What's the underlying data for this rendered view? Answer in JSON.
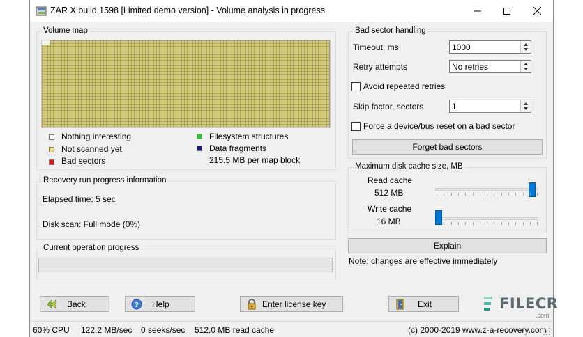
{
  "window": {
    "title": "ZAR X build 1598 [Limited demo version] - Volume analysis in progress"
  },
  "volume_map": {
    "title": "Volume map",
    "legend": [
      {
        "label": "Nothing interesting",
        "color": "#ffffff"
      },
      {
        "label": "Not scanned yet",
        "color": "#f2dc6a"
      },
      {
        "label": "Bad sectors",
        "color": "#e01010"
      },
      {
        "label": "Filesystem structures",
        "color": "#22cc22"
      },
      {
        "label": "Data fragments",
        "color": "#1a1a8a"
      }
    ],
    "per_block": "215.5 MB per map block"
  },
  "recovery": {
    "title": "Recovery run progress information",
    "elapsed": "Elapsed time: 5 sec",
    "disk_scan": "Disk scan: Full mode (0%)"
  },
  "current_op": {
    "title": "Current operation progress",
    "progress": 0
  },
  "bad_sector": {
    "title": "Bad sector handling",
    "timeout_label": "Timeout, ms",
    "timeout_value": "1000",
    "retry_label": "Retry attempts",
    "retry_value": "No retries",
    "avoid_label": "Avoid repeated retries",
    "avoid_checked": false,
    "skip_label": "Skip factor, sectors",
    "skip_value": "1",
    "reset_label": "Force a device/bus reset on a bad sector",
    "reset_checked": false,
    "forget_button": "Forget bad sectors"
  },
  "cache": {
    "title": "Maximum disk cache size, MB",
    "read_label": "Read cache",
    "read_value": "512 MB",
    "read_level": 1.0,
    "write_label": "Write cache",
    "write_value": "16 MB",
    "write_level": 0.0
  },
  "explain_button": "Explain",
  "note": "Note: changes are effective immediately",
  "buttons": {
    "back": "Back",
    "help": "Help",
    "license": "Enter license key",
    "exit": "Exit"
  },
  "status": {
    "cpu": "60% CPU",
    "speed": "122.2 MB/sec",
    "seeks": "0 seeks/sec",
    "cache": "512.0 MB read cache",
    "copyright": "(c) 2000-2019 www.z-a-recovery.com"
  },
  "watermark": {
    "brand": "FILECR",
    "suffix": ".com"
  },
  "icons": {
    "app": "zar-app-icon",
    "back": "double-arrow-left-icon",
    "help": "help-question-icon",
    "license": "padlock-icon",
    "exit": "exit-door-icon"
  },
  "colors": {
    "accent": "#0078d7",
    "map_fill": "#d8cc68",
    "watermark_green": "#2e9a8a"
  }
}
